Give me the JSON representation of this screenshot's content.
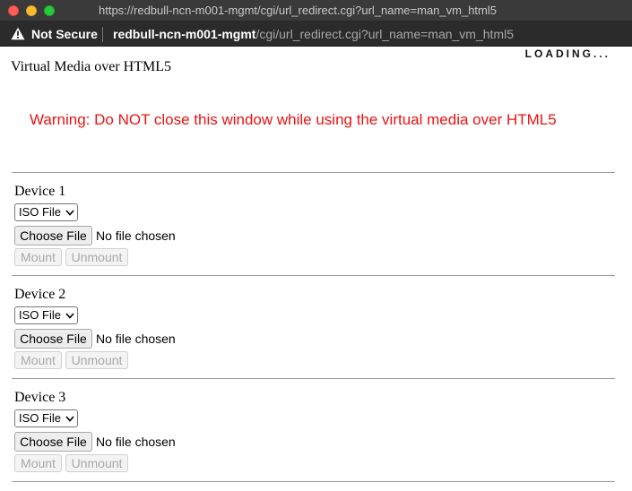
{
  "window": {
    "title": "https://redbull-ncn-m001-mgmt/cgi/url_redirect.cgi?url_name=man_vm_html5"
  },
  "addressbar": {
    "security_label": "Not Secure",
    "url_host": "redbull-ncn-m001-mgmt",
    "url_path": "/cgi/url_redirect.cgi?url_name=man_vm_html5"
  },
  "page": {
    "loading_text": "LOADING...",
    "title": "Virtual Media over HTML5",
    "warning": "Warning: Do NOT close this window while using the virtual media over HTML5",
    "warning_color": "#ee1111"
  },
  "devices": [
    {
      "label": "Device 1",
      "type_selected": "ISO File",
      "choose_label": "Choose File",
      "file_status": "No file chosen",
      "mount_label": "Mount",
      "unmount_label": "Unmount"
    },
    {
      "label": "Device 2",
      "type_selected": "ISO File",
      "choose_label": "Choose File",
      "file_status": "No file chosen",
      "mount_label": "Mount",
      "unmount_label": "Unmount"
    },
    {
      "label": "Device 3",
      "type_selected": "ISO File",
      "choose_label": "Choose File",
      "file_status": "No file chosen",
      "mount_label": "Mount",
      "unmount_label": "Unmount"
    }
  ]
}
